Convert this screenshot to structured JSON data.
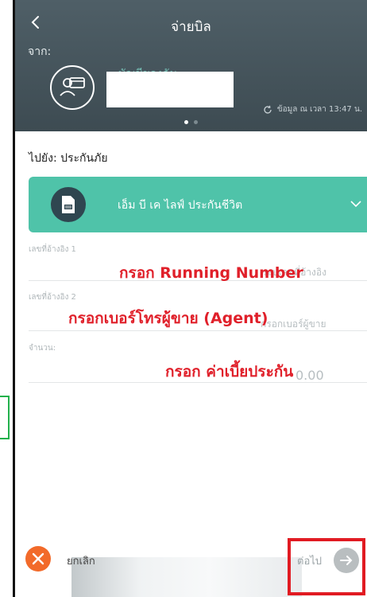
{
  "header": {
    "title": "จ่ายบิล",
    "from_label": "จาก:",
    "account_name_partial": "บัญชีของฉัน",
    "sync_text": "ข้อมูล ณ เวลา 13:47 น."
  },
  "body": {
    "to_label": "ไปยัง: ประกันภัย",
    "provider_name": "เอ็ม บี เค ไลฟ์ ประกันชีวิต",
    "fields": [
      {
        "label": "เลขที่อ้างอิง 1",
        "ghost": "ระบุเลขที่อ้างอิง"
      },
      {
        "label": "เลขที่อ้างอิง 2",
        "ghost": "กรอกเบอร์ผู้ขาย"
      },
      {
        "label": "จำนวน:",
        "ghost": "0.00"
      }
    ]
  },
  "annotations": {
    "ref1": "กรอก Running Number",
    "ref2": "กรอกเบอร์โทรผู้ขาย (Agent)",
    "amount": "กรอก ค่าเบี้ยประกัน"
  },
  "footer": {
    "cancel_label": "ยกเลิก",
    "next_label": "ต่อไป"
  },
  "colors": {
    "header_bg": "#46555c",
    "provider_bg": "#4fc3a9",
    "cancel": "#f26a2a",
    "annotation": "#e0202a",
    "highlight_box": "#e11b22",
    "side_marker": "#22b14c"
  }
}
